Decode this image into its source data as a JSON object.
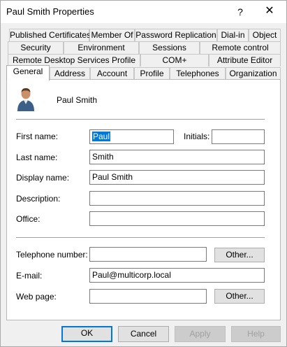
{
  "window": {
    "title": "Paul Smith Properties",
    "help_glyph": "?",
    "close_glyph": "✕"
  },
  "tabs": {
    "row1": [
      "Published Certificates",
      "Member Of",
      "Password Replication",
      "Dial-in",
      "Object"
    ],
    "row2": [
      "Security",
      "Environment",
      "Sessions",
      "Remote control"
    ],
    "row3": [
      "Remote Desktop Services Profile",
      "COM+",
      "Attribute Editor"
    ],
    "row4": [
      "General",
      "Address",
      "Account",
      "Profile",
      "Telephones",
      "Organization"
    ],
    "active": "General"
  },
  "general": {
    "user_name": "Paul Smith",
    "avatar_icon": "user-icon",
    "fields": {
      "first_name": {
        "label": "First name:",
        "value": "Paul"
      },
      "initials": {
        "label": "Initials:",
        "value": ""
      },
      "last_name": {
        "label": "Last name:",
        "value": "Smith"
      },
      "display_name": {
        "label": "Display name:",
        "value": "Paul Smith"
      },
      "description": {
        "label": "Description:",
        "value": ""
      },
      "office": {
        "label": "Office:",
        "value": ""
      },
      "telephone": {
        "label": "Telephone number:",
        "value": ""
      },
      "email": {
        "label": "E-mail:",
        "value": "Paul@multicorp.local"
      },
      "web_page": {
        "label": "Web page:",
        "value": ""
      }
    },
    "other_button": "Other..."
  },
  "footer": {
    "ok": "OK",
    "cancel": "Cancel",
    "apply": "Apply",
    "help": "Help"
  },
  "colors": {
    "accent": "#0078d7",
    "panel_bg": "#ffffff",
    "window_bg": "#f0f0f0"
  }
}
